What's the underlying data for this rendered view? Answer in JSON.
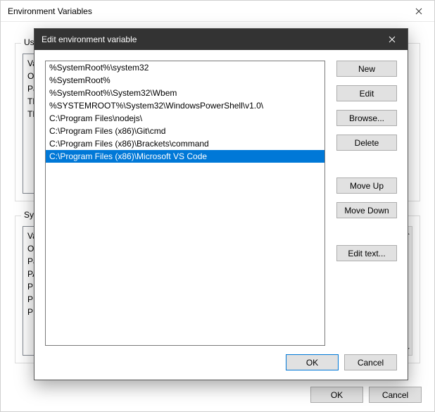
{
  "parent": {
    "title": "Environment Variables",
    "user_group_label": "User",
    "sys_group_label": "Syste",
    "user_vars": [
      "Va",
      "Or",
      "Pa",
      "TE",
      "TN"
    ],
    "sys_vars": [
      "Va",
      "OS",
      "Pa",
      "PA",
      "PR",
      "PR",
      "PR"
    ],
    "ok_label": "OK",
    "cancel_label": "Cancel"
  },
  "child": {
    "title": "Edit environment variable",
    "entries": [
      "%SystemRoot%\\system32",
      "%SystemRoot%",
      "%SystemRoot%\\System32\\Wbem",
      "%SYSTEMROOT%\\System32\\WindowsPowerShell\\v1.0\\",
      "C:\\Program Files\\nodejs\\",
      "C:\\Program Files (x86)\\Git\\cmd",
      "C:\\Program Files (x86)\\Brackets\\command",
      "C:\\Program Files (x86)\\Microsoft VS Code"
    ],
    "selected_index": 7,
    "buttons": {
      "new": "New",
      "edit": "Edit",
      "browse": "Browse...",
      "delete": "Delete",
      "move_up": "Move Up",
      "move_down": "Move Down",
      "edit_text": "Edit text..."
    },
    "ok_label": "OK",
    "cancel_label": "Cancel"
  }
}
